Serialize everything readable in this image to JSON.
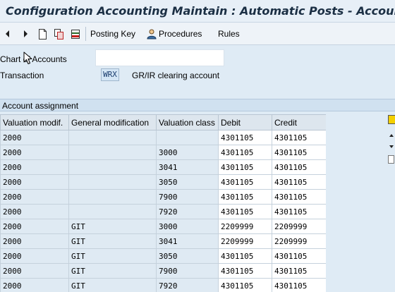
{
  "window": {
    "title": "Configuration Accounting Maintain : Automatic Posts - Accounts"
  },
  "toolbar": {
    "posting_key_label": "Posting Key",
    "procedures_label": "Procedures",
    "rules_label": "Rules"
  },
  "header": {
    "chart_of_accounts_label": "Chart of Accounts",
    "chart_of_accounts_value": "",
    "transaction_label": "Transaction",
    "transaction_code": "WRX",
    "transaction_description": "GR/IR clearing account"
  },
  "section": {
    "title": "Account assignment"
  },
  "table": {
    "columns": [
      "Valuation modif.",
      "General modification",
      "Valuation class",
      "Debit",
      "Credit"
    ],
    "rows": [
      [
        "2000",
        "",
        "",
        "4301105",
        "4301105"
      ],
      [
        "2000",
        "",
        "3000",
        "4301105",
        "4301105"
      ],
      [
        "2000",
        "",
        "3041",
        "4301105",
        "4301105"
      ],
      [
        "2000",
        "",
        "3050",
        "4301105",
        "4301105"
      ],
      [
        "2000",
        "",
        "7900",
        "4301105",
        "4301105"
      ],
      [
        "2000",
        "",
        "7920",
        "4301105",
        "4301105"
      ],
      [
        "2000",
        "GIT",
        "3000",
        "2209999",
        "2209999"
      ],
      [
        "2000",
        "GIT",
        "3041",
        "2209999",
        "2209999"
      ],
      [
        "2000",
        "GIT",
        "3050",
        "4301105",
        "4301105"
      ],
      [
        "2000",
        "GIT",
        "7900",
        "4301105",
        "4301105"
      ],
      [
        "2000",
        "GIT",
        "7920",
        "4301105",
        "4301105"
      ]
    ]
  },
  "colors": {
    "background": "#dfebf5",
    "title_text": "#1b2f44",
    "grid_key_cell": "#dfeaf3",
    "grid_value_cell": "#ffffff"
  }
}
